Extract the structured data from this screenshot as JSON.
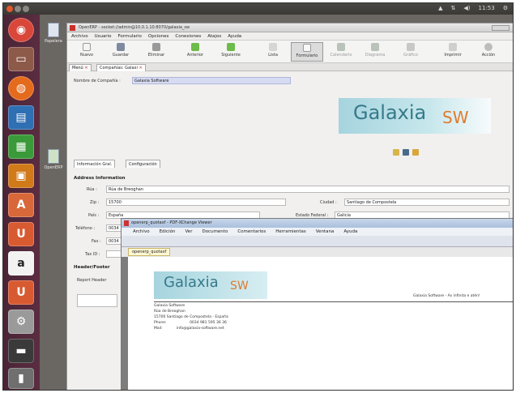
{
  "tray": {
    "clock": "11:53"
  },
  "desktop": {
    "icons": [
      {
        "label": "Papelera"
      },
      {
        "label": "OpenERP"
      }
    ]
  },
  "erp": {
    "title": "OpenERP - socket://admin@10.0.1.10:8070/galaxia_sw",
    "menu": [
      "Archivo",
      "Usuario",
      "Formulario",
      "Opciones",
      "Conexiones",
      "Atajos",
      "Ayuda"
    ],
    "toolbar": [
      "Nuevo",
      "Guardar",
      "Eliminar",
      "Anterior",
      "Siguiente",
      "Lista",
      "Formulario",
      "Calendario",
      "Diagrama",
      "Gráfico",
      "Imprimir",
      "Acción"
    ],
    "tabs": [
      "Menú",
      "Compañías: Galaxi"
    ],
    "form": {
      "company_label": "Nombre de Compañía :",
      "company_value": "Galaxia Software",
      "subtabs": [
        "Información Gral.",
        "Configuración"
      ],
      "section_address": "Address Information",
      "street_label": "Rúa :",
      "street_value": "Rúa de Breoghan",
      "zip_label": "Zip :",
      "zip_value": "15700",
      "city_label": "Ciudad :",
      "city_value": "Santiago de Compostela",
      "country_label": "País :",
      "country_value": "España",
      "state_label": "Estado Federal :",
      "state_value": "Galicia",
      "phone_label": "Teléfono :",
      "phone_value": "0034",
      "fax_label": "Fax :",
      "fax_value": "0034",
      "taxid_label": "Tax ID :",
      "section_header": "Header/Footer",
      "report_label": "Report Header",
      "logo_main": "Galaxia",
      "logo_sub": "SW"
    }
  },
  "pdf": {
    "title": "openerp_quotaxf - PDF-XChange Viewer",
    "menu": [
      "Archivo",
      "Edición",
      "Ver",
      "Documento",
      "Comentarios",
      "Herramientas",
      "Ventana",
      "Ayuda"
    ],
    "tab": "openerp_quotaxf",
    "header_right": "Galaxia Software - As infinita e atén!",
    "lines": [
      "Galaxia Software",
      "Rúa de Breoghan",
      "15700 Santiago de Compostela - España",
      "Phone:                    0034 981 595 36 36",
      "Mail:            info@galaxia-software.net"
    ]
  }
}
